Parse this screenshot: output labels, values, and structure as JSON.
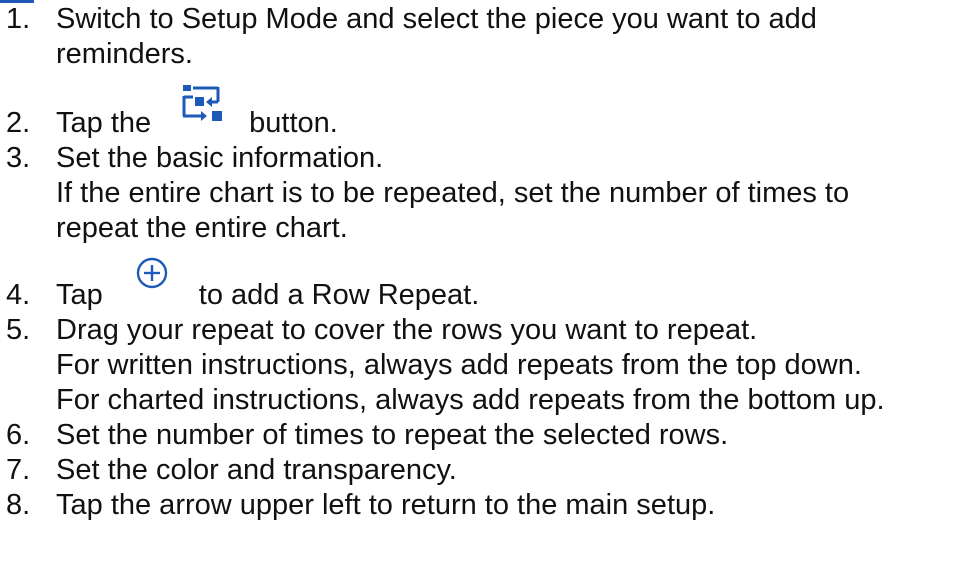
{
  "steps": [
    {
      "num": "1.",
      "lines": [
        "Switch to Setup Mode and select the piece you want to add",
        "reminders."
      ]
    },
    {
      "num": "2.",
      "before": "Tap the",
      "icon": "repeat-settings-icon",
      "after": "button."
    },
    {
      "num": "3.",
      "lines": [
        "Set the basic information.",
        "If the entire chart is to be repeated, set the number of times to",
        "repeat the entire chart."
      ]
    },
    {
      "num": "4.",
      "before": "Tap",
      "icon": "add-circle-icon",
      "after": "to add a Row Repeat."
    },
    {
      "num": "5.",
      "lines": [
        "Drag your repeat to cover the rows you want to repeat.",
        "For written instructions, always add repeats from the top down.",
        "For charted instructions, always add repeats from the bottom up."
      ]
    },
    {
      "num": "6.",
      "lines": [
        "Set the number of times to repeat the selected rows."
      ]
    },
    {
      "num": "7.",
      "lines": [
        "Set the color and transparency."
      ]
    },
    {
      "num": "8.",
      "lines": [
        "Tap the arrow upper left to return to the main setup."
      ]
    }
  ],
  "colors": {
    "accent": "#1e5bb8",
    "text": "#111111"
  }
}
